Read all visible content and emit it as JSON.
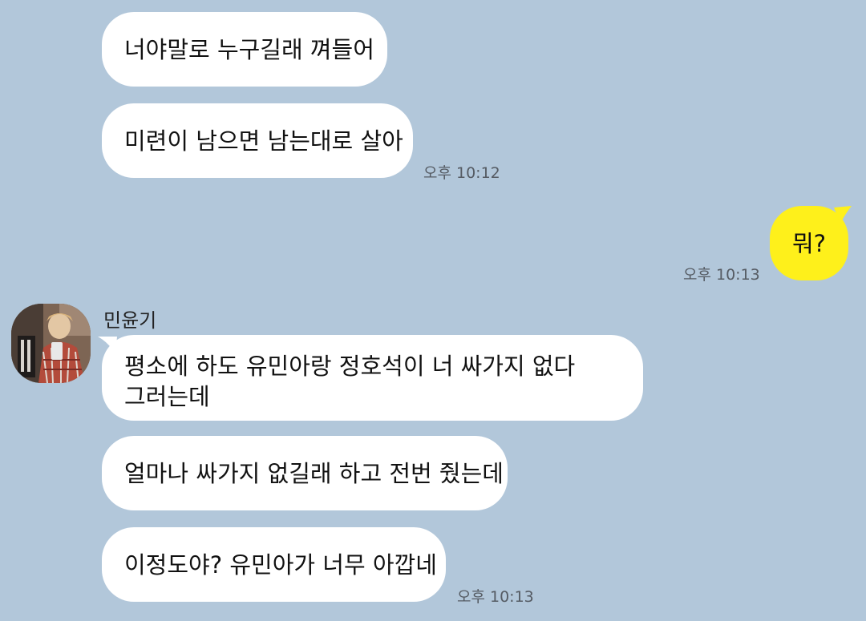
{
  "messages": [
    {
      "id": "m1",
      "text": "너야말로 누구길래 껴들어"
    },
    {
      "id": "m2",
      "text": "미련이 남으면 남는대로 살아",
      "time": "오후 10:12"
    },
    {
      "id": "m3",
      "text": "뭐?",
      "time": "오후 10:13"
    },
    {
      "id": "m4",
      "sender": "민윤기",
      "line1": "평소에 하도 유민아랑 정호석이 너 싸가지 없다",
      "line2": "그러는데"
    },
    {
      "id": "m5",
      "text": "얼마나 싸가지 없길래 하고 전번 줬는데"
    },
    {
      "id": "m6",
      "text": "이정도야? 유민아가 너무 아깝네",
      "time": "오후 10:13"
    }
  ],
  "colors": {
    "background": "#b2c7da",
    "incoming_bubble": "#ffffff",
    "outgoing_bubble": "#fef01b"
  }
}
